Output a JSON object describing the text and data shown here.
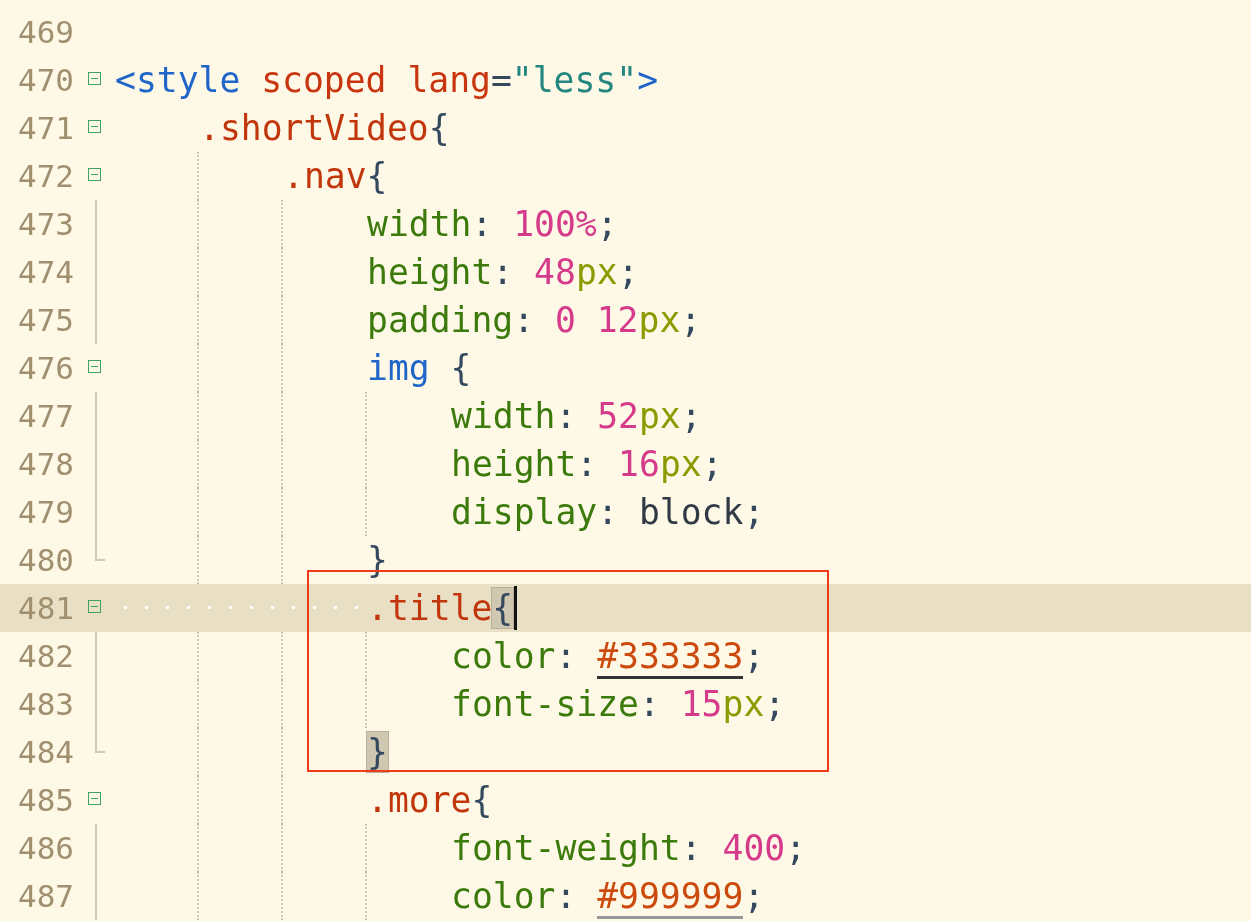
{
  "editor": {
    "lines": [
      {
        "number": "469",
        "current": false,
        "boxed": false
      },
      {
        "number": "470",
        "kind": "start",
        "current": false,
        "boxed": false,
        "tokens": [
          {
            "kind": "tag",
            "text": "<style"
          },
          {
            "kind": "attr",
            "text": " scoped lang"
          },
          {
            "kind": "punct",
            "text": "="
          },
          {
            "kind": "string",
            "text": "\"less\""
          },
          {
            "kind": "tag",
            "text": ">"
          }
        ],
        "children": [
          {
            "number": "471",
            "kind": "start",
            "current": false,
            "boxed": false,
            "tokens": [
              {
                "kind": "selector",
                "text": ".shortVideo"
              },
              {
                "kind": "punct",
                "text": "{"
              }
            ],
            "children": [
              {
                "number": "472",
                "kind": "start",
                "current": false,
                "boxed": false,
                "tokens": [
                  {
                    "kind": "selector",
                    "text": ".nav"
                  },
                  {
                    "kind": "punct",
                    "text": "{"
                  }
                ],
                "children": [
                  {
                    "number": "473",
                    "kind": "inside",
                    "current": false,
                    "boxed": false,
                    "tokens": [
                      {
                        "kind": "prop",
                        "text": "width"
                      },
                      {
                        "kind": "punct",
                        "text": ": "
                      },
                      {
                        "kind": "number",
                        "text": "100%"
                      },
                      {
                        "kind": "punct",
                        "text": ";"
                      }
                    ]
                  },
                  {
                    "number": "474",
                    "kind": "inside",
                    "current": false,
                    "boxed": false,
                    "tokens": [
                      {
                        "kind": "prop",
                        "text": "height"
                      },
                      {
                        "kind": "punct",
                        "text": ": "
                      },
                      {
                        "kind": "number",
                        "text": "48"
                      },
                      {
                        "kind": "unit",
                        "text": "px"
                      },
                      {
                        "kind": "punct",
                        "text": ";"
                      }
                    ]
                  },
                  {
                    "number": "475",
                    "kind": "inside",
                    "current": false,
                    "boxed": false,
                    "tokens": [
                      {
                        "kind": "prop",
                        "text": "padding"
                      },
                      {
                        "kind": "punct",
                        "text": ": "
                      },
                      {
                        "kind": "number",
                        "text": "0 12"
                      },
                      {
                        "kind": "unit",
                        "text": "px"
                      },
                      {
                        "kind": "punct",
                        "text": ";"
                      }
                    ]
                  },
                  {
                    "number": "476",
                    "kind": "start",
                    "current": false,
                    "boxed": false,
                    "tokens": [
                      {
                        "kind": "tag",
                        "text": "img"
                      },
                      {
                        "kind": "punct",
                        "text": " {"
                      }
                    ],
                    "children": [
                      {
                        "number": "477",
                        "kind": "inside",
                        "current": false,
                        "boxed": false,
                        "tokens": [
                          {
                            "kind": "prop",
                            "text": "width"
                          },
                          {
                            "kind": "punct",
                            "text": ": "
                          },
                          {
                            "kind": "number",
                            "text": "52"
                          },
                          {
                            "kind": "unit",
                            "text": "px"
                          },
                          {
                            "kind": "punct",
                            "text": ";"
                          }
                        ]
                      },
                      {
                        "number": "478",
                        "kind": "inside",
                        "current": false,
                        "boxed": false,
                        "tokens": [
                          {
                            "kind": "prop",
                            "text": "height"
                          },
                          {
                            "kind": "punct",
                            "text": ": "
                          },
                          {
                            "kind": "number",
                            "text": "16"
                          },
                          {
                            "kind": "unit",
                            "text": "px"
                          },
                          {
                            "kind": "punct",
                            "text": ";"
                          }
                        ]
                      },
                      {
                        "number": "479",
                        "kind": "inside",
                        "current": false,
                        "boxed": false,
                        "tokens": [
                          {
                            "kind": "prop",
                            "text": "display"
                          },
                          {
                            "kind": "punct",
                            "text": ": "
                          },
                          {
                            "kind": "value",
                            "text": "block"
                          },
                          {
                            "kind": "punct",
                            "text": ";"
                          }
                        ]
                      }
                    ]
                  },
                  {
                    "number": "480",
                    "kind": "end",
                    "current": false,
                    "boxed": false,
                    "tokens": [
                      {
                        "kind": "punct",
                        "text": "}"
                      }
                    ]
                  },
                  {
                    "number": "481",
                    "kind": "start",
                    "current": true,
                    "boxed": true,
                    "tokens": [
                      {
                        "kind": "selector",
                        "text": ".title"
                      },
                      {
                        "kind": "punct",
                        "text": "{",
                        "matched": true
                      }
                    ],
                    "children": [
                      {
                        "number": "482",
                        "kind": "inside",
                        "current": false,
                        "boxed": true,
                        "tokens": [
                          {
                            "kind": "prop",
                            "text": "color"
                          },
                          {
                            "kind": "punct",
                            "text": ": "
                          },
                          {
                            "kind": "hex",
                            "text": "#333333",
                            "color": "#333333"
                          },
                          {
                            "kind": "punct",
                            "text": ";"
                          }
                        ]
                      },
                      {
                        "number": "483",
                        "kind": "inside",
                        "current": false,
                        "boxed": true,
                        "tokens": [
                          {
                            "kind": "prop",
                            "text": "font-size"
                          },
                          {
                            "kind": "punct",
                            "text": ": "
                          },
                          {
                            "kind": "number",
                            "text": "15"
                          },
                          {
                            "kind": "unit",
                            "text": "px"
                          },
                          {
                            "kind": "punct",
                            "text": ";"
                          }
                        ]
                      }
                    ]
                  },
                  {
                    "number": "484",
                    "kind": "end",
                    "current": false,
                    "boxed": true,
                    "tokens": [
                      {
                        "kind": "punct",
                        "text": "}",
                        "matched": true
                      }
                    ]
                  },
                  {
                    "number": "485",
                    "kind": "start",
                    "current": false,
                    "boxed": false,
                    "tokens": [
                      {
                        "kind": "selector",
                        "text": ".more"
                      },
                      {
                        "kind": "punct",
                        "text": "{"
                      }
                    ],
                    "children": [
                      {
                        "number": "486",
                        "kind": "inside",
                        "current": false,
                        "boxed": false,
                        "tokens": [
                          {
                            "kind": "prop",
                            "text": "font-weight"
                          },
                          {
                            "kind": "punct",
                            "text": ": "
                          },
                          {
                            "kind": "number",
                            "text": "400"
                          },
                          {
                            "kind": "punct",
                            "text": ";"
                          }
                        ]
                      },
                      {
                        "number": "487",
                        "kind": "inside",
                        "current": false,
                        "boxed": false,
                        "tokens": [
                          {
                            "kind": "prop",
                            "text": "color"
                          },
                          {
                            "kind": "punct",
                            "text": ": "
                          },
                          {
                            "kind": "hex",
                            "text": "#999999",
                            "color": "#999999"
                          },
                          {
                            "kind": "punct",
                            "text": ";"
                          }
                        ]
                      }
                    ]
                  }
                ]
              }
            ]
          }
        ]
      }
    ]
  }
}
